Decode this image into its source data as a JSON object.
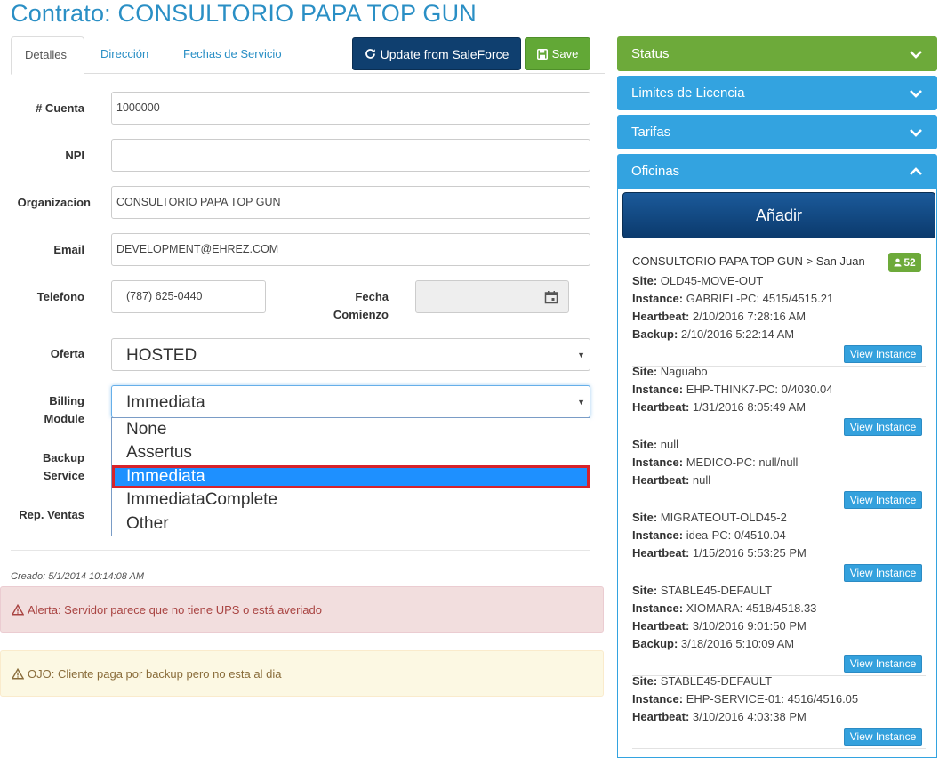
{
  "page": {
    "title": "Contrato: CONSULTORIO PAPA TOP GUN"
  },
  "tabs": [
    "Detalles",
    "Dirección",
    "Fechas de Servicio"
  ],
  "toolbar": {
    "salesforce_label": "Update from SaleForce",
    "save_label": "Save"
  },
  "form": {
    "cuenta_label": "# Cuenta",
    "cuenta_value": "1000000",
    "npi_label": "NPI",
    "npi_value": "",
    "organizacion_label": "Organizacion",
    "organizacion_value": "CONSULTORIO PAPA TOP GUN",
    "email_label": "Email",
    "email_value": "DEVELOPMENT@EHREZ.COM",
    "telefono_label": "Telefono",
    "telefono_value": "(787) 625-0440",
    "fecha_label_1": "Fecha",
    "fecha_label_2": "Comienzo",
    "fecha_value": "",
    "oferta_label": "Oferta",
    "oferta_value": "HOSTED",
    "billing_label_1": "Billing",
    "billing_label_2": "Module",
    "billing_value": "Immediata",
    "backup_label_1": "Backup",
    "backup_label_2": "Service",
    "rep_label": "Rep. Ventas"
  },
  "billing_options": [
    "None",
    "Assertus",
    "Immediata",
    "ImmediataComplete",
    "Other"
  ],
  "billing_selected_index": 2,
  "footer": {
    "creado": "Creado: 5/1/2014 10:14:08 AM",
    "alert_danger": "Alerta: Servidor parece que no tiene UPS o está averiado",
    "alert_warning": "OJO: Cliente paga por backup pero no esta al dia"
  },
  "panels": {
    "status": "Status",
    "limites": "Limites de Licencia",
    "tarifas": "Tarifas",
    "oficinas": "Oficinas",
    "add_label": "Añadir",
    "office_title": "CONSULTORIO PAPA TOP GUN > San Juan",
    "office_count": "52",
    "view_instance_label": "View Instance",
    "instances": [
      {
        "site": "OLD45-MOVE-OUT",
        "instance": "GABRIEL-PC: 4515/4515.21",
        "heartbeat": "2/10/2016 7:28:16 AM",
        "backup": "2/10/2016 5:22:14 AM"
      },
      {
        "site": "Naguabo",
        "instance": "EHP-THINK7-PC: 0/4030.04",
        "heartbeat": "1/31/2016 8:05:49 AM"
      },
      {
        "site": "null",
        "instance": "MEDICO-PC: null/null",
        "heartbeat": "null"
      },
      {
        "site": "MIGRATEOUT-OLD45-2",
        "instance": "idea-PC: 0/4510.04",
        "heartbeat": "1/15/2016 5:53:25 PM"
      },
      {
        "site": "STABLE45-DEFAULT",
        "instance": "XIOMARA: 4518/4518.33",
        "heartbeat": "3/10/2016 9:01:50 PM",
        "backup": "3/18/2016 5:10:09 AM"
      },
      {
        "site": "STABLE45-DEFAULT",
        "instance": "EHP-SERVICE-01: 4516/4516.05",
        "heartbeat": "3/10/2016 4:03:38 PM"
      }
    ],
    "field_labels": {
      "site": "Site:",
      "instance": "Instance:",
      "heartbeat": "Heartbeat:",
      "backup": "Backup:"
    }
  },
  "colors": {
    "title": "#2a8fc5",
    "status_panel": "#6daa3a",
    "blue_panel": "#33a3e0",
    "primary_button": "#0f3f6f",
    "save_button": "#62a836",
    "selected_option": "#1e90ff",
    "selection_outline": "#d7232b"
  }
}
